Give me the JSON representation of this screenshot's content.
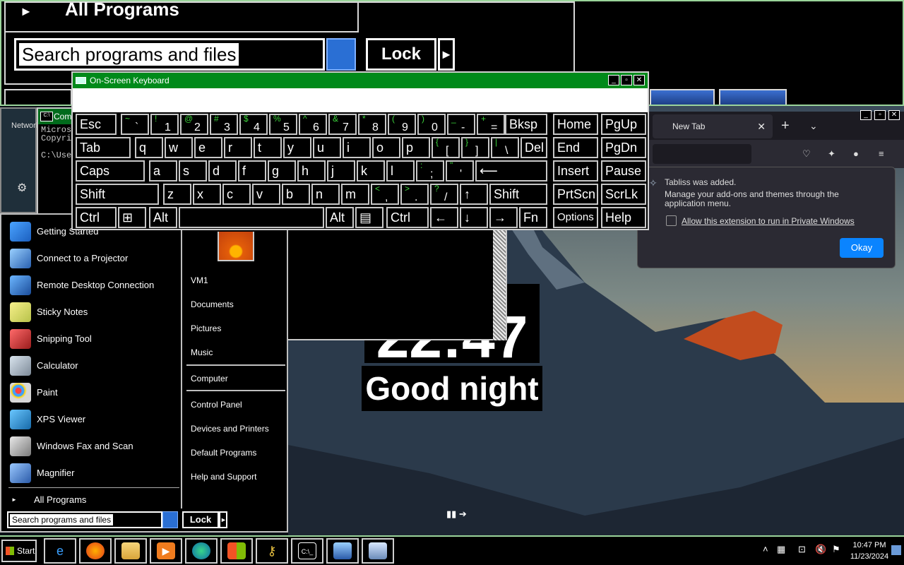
{
  "magnifier": {
    "all_programs": "All Programs",
    "search_text": "Search programs and files",
    "lock": "Lock"
  },
  "cmd": {
    "title": "Com",
    "lines": [
      "Micros",
      "Copyri",
      "",
      "C:\\Use"
    ]
  },
  "left_strip": {
    "network": "Network"
  },
  "browser": {
    "tab_title": "New Tab",
    "popup": {
      "title": "Tabliss was added.",
      "message": "Manage your add-ons and themes through the application menu.",
      "checkbox_label": "Allow this extension to run in Private Windows",
      "okay": "Okay"
    },
    "clock": "22:47",
    "greeting": "Good night"
  },
  "osk": {
    "title": "On-Screen Keyboard",
    "rows": [
      [
        "Esc",
        {
          "s": "~",
          "m": "`"
        },
        {
          "s": "!",
          "m": "1"
        },
        {
          "s": "@",
          "m": "2"
        },
        {
          "s": "#",
          "m": "3"
        },
        {
          "s": "$",
          "m": "4"
        },
        {
          "s": "%",
          "m": "5"
        },
        {
          "s": "^",
          "m": "6"
        },
        {
          "s": "&",
          "m": "7"
        },
        {
          "s": "*",
          "m": "8"
        },
        {
          "s": "(",
          "m": "9"
        },
        {
          "s": ")",
          "m": "0"
        },
        {
          "s": "_",
          "m": "-"
        },
        {
          "s": "+",
          "m": "="
        },
        "Bksp",
        "Home",
        "PgUp"
      ],
      [
        "Tab",
        "q",
        "w",
        "e",
        "r",
        "t",
        "y",
        "u",
        "i",
        "o",
        "p",
        {
          "s": "{",
          "m": "["
        },
        {
          "s": "}",
          "m": "]"
        },
        {
          "s": "|",
          "m": "\\"
        },
        "Del",
        "End",
        "PgDn"
      ],
      [
        "Caps",
        "a",
        "s",
        "d",
        "f",
        "g",
        "h",
        "j",
        "k",
        "l",
        {
          "s": ":",
          "m": ";"
        },
        {
          "s": "\"",
          "m": "'"
        },
        "⟵",
        "Insert",
        "Pause"
      ],
      [
        "Shift",
        "z",
        "x",
        "c",
        "v",
        "b",
        "n",
        "m",
        {
          "s": "<",
          "m": ","
        },
        {
          "s": ">",
          "m": "."
        },
        {
          "s": "?",
          "m": "/"
        },
        "↑",
        "Shift",
        "PrtScn",
        "ScrLk"
      ],
      [
        "Ctrl",
        "⊞",
        "Alt",
        "",
        "Alt",
        "▤",
        "Ctrl",
        "←",
        "↓",
        "→",
        "Fn",
        "Options",
        "Help"
      ]
    ]
  },
  "start_menu": {
    "programs": [
      "Getting Started",
      "Connect to a Projector",
      "Remote Desktop Connection",
      "Sticky Notes",
      "Snipping Tool",
      "Calculator",
      "Paint",
      "XPS Viewer",
      "Windows Fax and Scan",
      "Magnifier"
    ],
    "all_programs": "All Programs",
    "right_links": [
      "VM1",
      "Documents",
      "Pictures",
      "Music",
      "Computer",
      "Control Panel",
      "Devices and Printers",
      "Default Programs",
      "Help and Support"
    ],
    "search_text": "Search programs and files",
    "lock": "Lock"
  },
  "taskbar": {
    "start": "Start",
    "apps": [
      "internet-explorer",
      "firefox",
      "file-explorer",
      "media-player",
      "edge",
      "windows-update",
      "credential-keys",
      "command-prompt",
      "remote-desktop",
      "on-screen-keyboard"
    ],
    "time": "10:47 PM",
    "date": "11/23/2024"
  },
  "colors": {
    "title_green": "#008a1a",
    "shift_green": "#3bd43b",
    "accent_blue": "#0a84ff"
  }
}
